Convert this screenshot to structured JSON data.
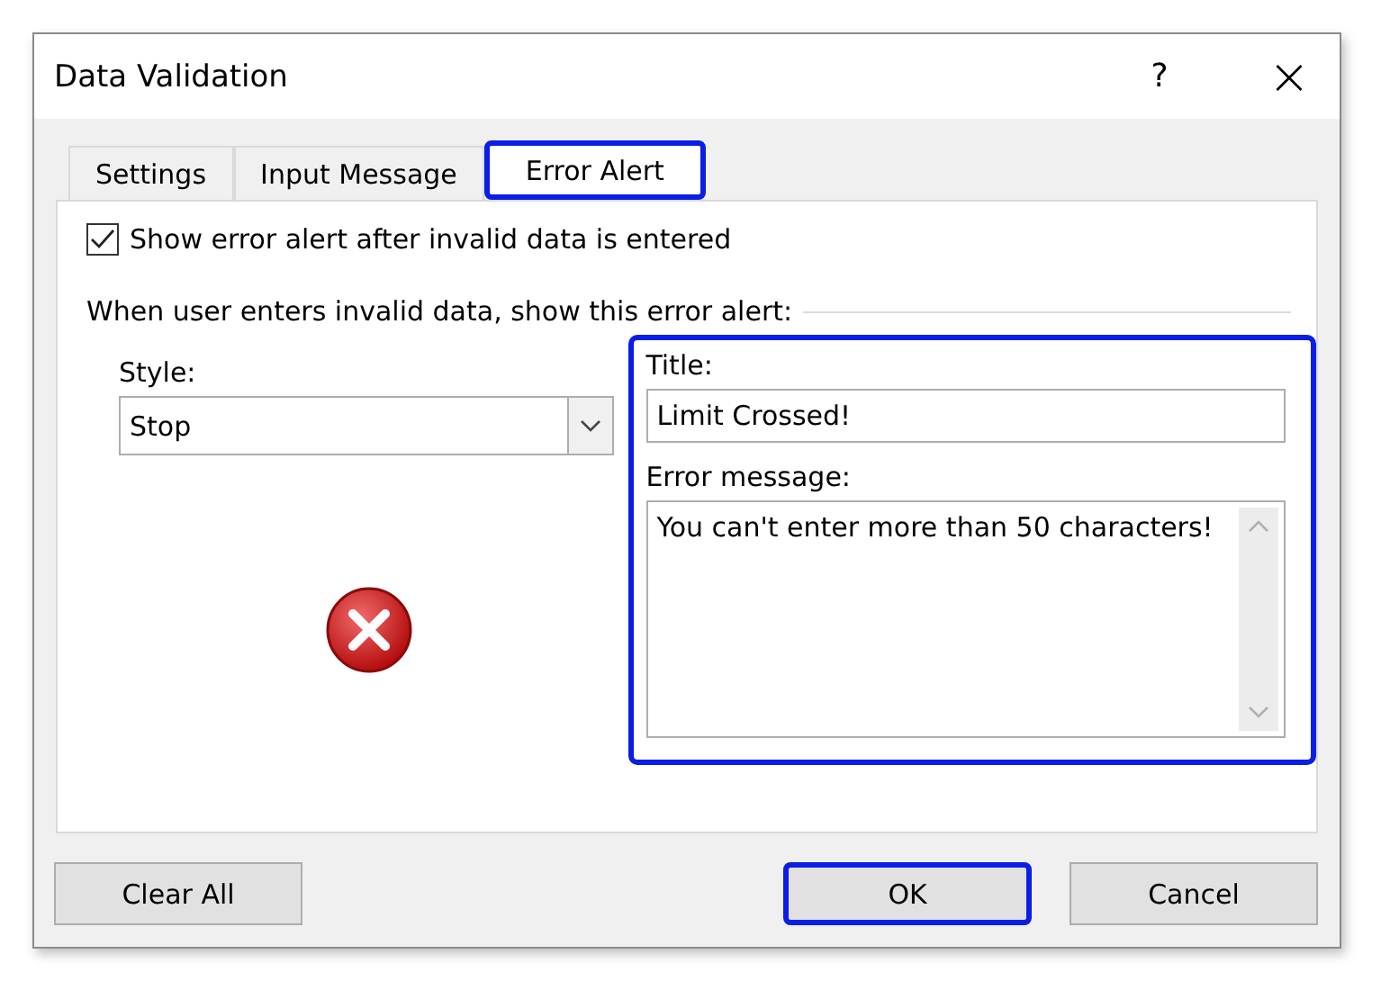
{
  "window": {
    "title": "Data Validation",
    "help": "?",
    "close": "×"
  },
  "tabs": [
    {
      "label": "Settings",
      "selected": false,
      "highlighted": false
    },
    {
      "label": "Input Message",
      "selected": false,
      "highlighted": false
    },
    {
      "label": "Error Alert",
      "selected": true,
      "highlighted": true
    }
  ],
  "show_alert": {
    "label": "Show error alert after invalid data is entered",
    "checked": true
  },
  "section_heading": "When user enters invalid data, show this error alert:",
  "style": {
    "label": "Style:",
    "value": "Stop"
  },
  "alert_fields": {
    "highlighted": true,
    "title_label": "Title:",
    "title_value": "Limit Crossed!",
    "message_label": "Error message:",
    "message_value": "You can't enter more than 50 characters!"
  },
  "buttons": [
    {
      "label": "Clear All",
      "highlighted": false
    },
    {
      "label": "OK",
      "highlighted": true
    },
    {
      "label": "Cancel",
      "highlighted": false
    }
  ]
}
